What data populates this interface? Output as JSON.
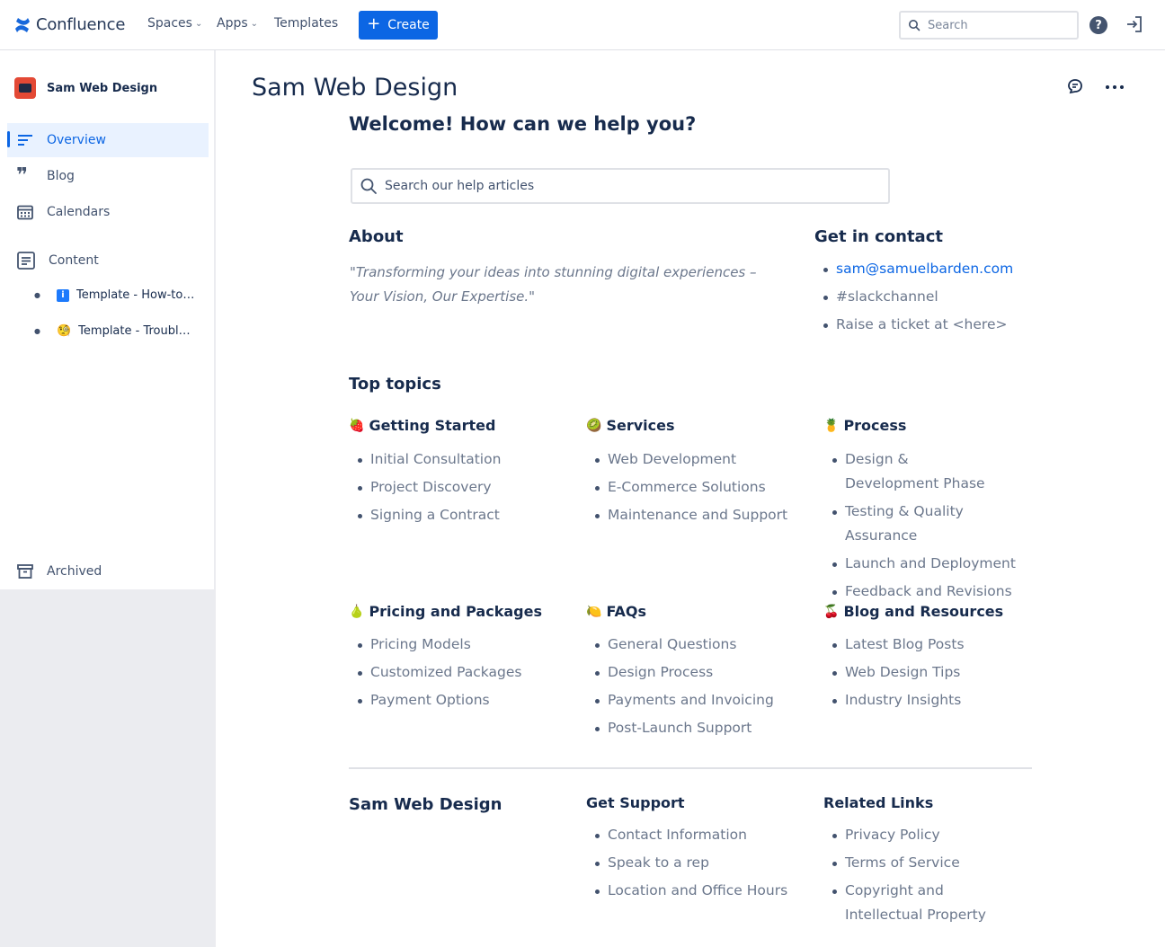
{
  "nav": {
    "brand": "Confluence",
    "spaces": "Spaces",
    "apps": "Apps",
    "templates": "Templates",
    "create": "Create",
    "search_placeholder": "Search"
  },
  "sidebar": {
    "space_name": "Sam Web Design",
    "items": [
      {
        "label": "Overview"
      },
      {
        "label": "Blog"
      },
      {
        "label": "Calendars"
      },
      {
        "label": "Content"
      }
    ],
    "children": [
      {
        "label": "Template - How-to…"
      },
      {
        "label": "Template - Troubl…"
      }
    ],
    "archived": "Archived"
  },
  "page": {
    "title": "Sam Web Design",
    "welcome": "Welcome! How can we help you?",
    "help_search_placeholder": "Search our help articles",
    "about": {
      "heading": "About",
      "quote": "\"Transforming your ideas into stunning digital experiences – Your Vision, Our Expertise.\""
    },
    "contact": {
      "heading": "Get in contact",
      "items": [
        "sam@samuelbarden.com",
        "#slackchannel",
        "Raise a ticket at <here>"
      ]
    },
    "top_topics": "Top topics",
    "topics": [
      {
        "title": "Getting Started",
        "emoji": "🍓",
        "items": [
          "Initial Consultation",
          "Project Discovery",
          "Signing a Contract"
        ]
      },
      {
        "title": "Services",
        "emoji": "🥝",
        "items": [
          "Web Development",
          "E-Commerce Solutions",
          "Maintenance and Support"
        ]
      },
      {
        "title": "Process",
        "emoji": "🍍",
        "items": [
          "Design & Development Phase",
          "Testing & Quality Assurance",
          "Launch and Deployment",
          "Feedback and Revisions"
        ]
      },
      {
        "title": "Pricing and Packages",
        "emoji": "🍐",
        "items": [
          "Pricing Models",
          "Customized Packages",
          "Payment Options"
        ]
      },
      {
        "title": "FAQs",
        "emoji": "🍋",
        "items": [
          "General Questions",
          "Design Process",
          "Payments and Invoicing",
          "Post-Launch Support"
        ]
      },
      {
        "title": "Blog and Resources",
        "emoji": "🍒",
        "items": [
          "Latest Blog Posts",
          "Web Design Tips",
          "Industry Insights"
        ]
      }
    ],
    "footer": {
      "title": "Sam Web Design",
      "support": {
        "heading": "Get Support",
        "items": [
          "Contact Information",
          "Speak to a rep",
          "Location and Office Hours"
        ]
      },
      "links": {
        "heading": "Related Links",
        "items": [
          "Privacy Policy",
          "Terms of Service",
          "Copyright and Intellectual Property"
        ]
      }
    }
  }
}
